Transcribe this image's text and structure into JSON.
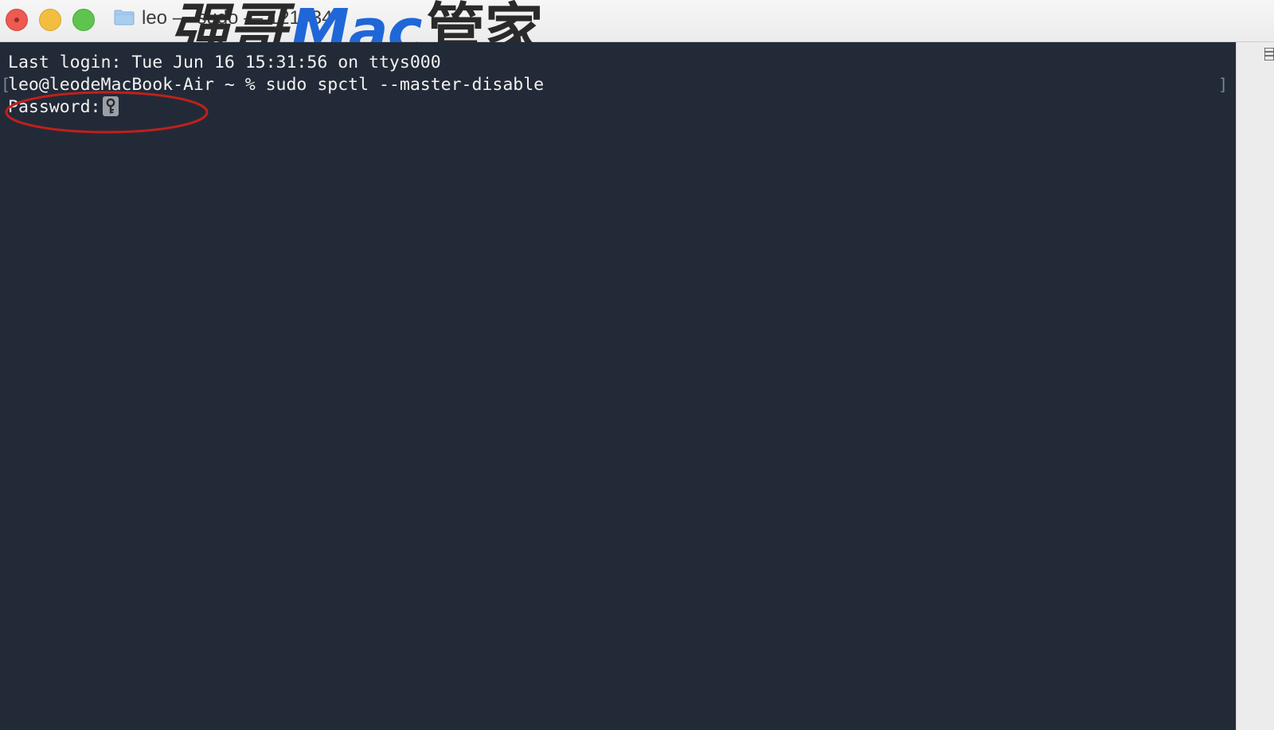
{
  "window": {
    "title": "leo — sudo — 121×34",
    "traffic_lights": [
      "close",
      "minimize",
      "zoom"
    ]
  },
  "watermark": {
    "cn_left": "强哥",
    "mac": "Mac",
    "cn_right": "管家"
  },
  "terminal": {
    "lines": [
      "Last login: Tue Jun 16 15:31:56 on ttys000",
      "leo@leodeMacBook-Air ~ % sudo spctl --master-disable",
      "Password:"
    ],
    "cursor_icon": "key-icon"
  },
  "colors": {
    "terminal_bg": "#232a37",
    "text": "#f2f2f2",
    "annotation": "#c0201c",
    "watermark_blue": "#1f67d8"
  }
}
